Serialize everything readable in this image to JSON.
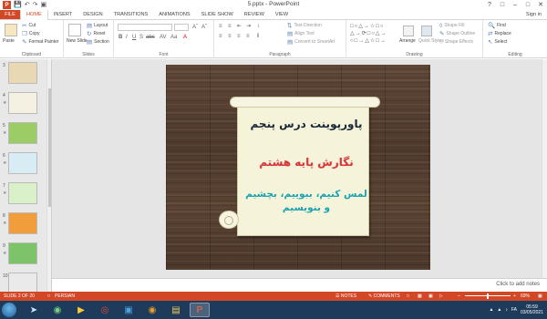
{
  "window": {
    "title": "5.pptx - PowerPoint",
    "signin": "Sign in"
  },
  "tabs": [
    "FILE",
    "HOME",
    "INSERT",
    "DESIGN",
    "TRANSITIONS",
    "ANIMATIONS",
    "SLIDE SHOW",
    "REVIEW",
    "VIEW"
  ],
  "ribbon": {
    "clipboard": {
      "label": "Clipboard",
      "paste": "Paste",
      "cut": "Cut",
      "copy": "Copy",
      "format_painter": "Format Painter"
    },
    "slides": {
      "label": "Slides",
      "new_slide": "New Slide",
      "layout": "Layout",
      "reset": "Reset",
      "section": "Section"
    },
    "font": {
      "label": "Font"
    },
    "paragraph": {
      "label": "Paragraph",
      "text_direction": "Text Direction",
      "align_text": "Align Text",
      "convert_smartart": "Convert to SmartArt"
    },
    "drawing": {
      "label": "Drawing",
      "arrange": "Arrange",
      "quick_styles": "Quick Styles",
      "shape_fill": "Shape Fill",
      "shape_outline": "Shape Outline",
      "shape_effects": "Shape Effects"
    },
    "editing": {
      "label": "Editing",
      "find": "Find",
      "replace": "Replace",
      "select": "Select"
    }
  },
  "thumbnails": [
    {
      "num": "3",
      "color": "#e9d8b4"
    },
    {
      "num": "4",
      "color": "#f4f0e2"
    },
    {
      "num": "5",
      "color": "#9ccc65"
    },
    {
      "num": "6",
      "color": "#d8ecf4"
    },
    {
      "num": "7",
      "color": "#d9f0c8"
    },
    {
      "num": "8",
      "color": "#f29d3b"
    },
    {
      "num": "9",
      "color": "#7cc36a"
    },
    {
      "num": "10",
      "color": "#eaeaea"
    }
  ],
  "slide": {
    "line1": "پاورپوینت درس پنجم",
    "line2": "نگارش پایه هشتم",
    "line3": "لمس کنیم، ببوییم، بچشیم و بنویسیم"
  },
  "notes_placeholder": "Click to add notes",
  "status": {
    "slide_info": "SLIDE 2 OF 20",
    "language": "PERSIAN",
    "notes": "NOTES",
    "comments": "COMMENTS",
    "zoom": "69%"
  },
  "taskbar": {
    "lang": "FA",
    "time": "05:59",
    "date": "03/05/2021"
  }
}
